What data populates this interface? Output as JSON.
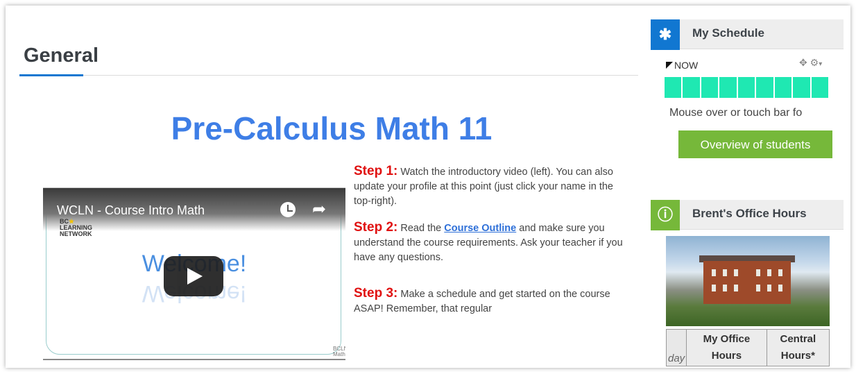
{
  "section": {
    "title": "General"
  },
  "course": {
    "title": "Pre-Calculus Math 11"
  },
  "video": {
    "title": "WCLN - Course Intro Math",
    "brand": [
      "BC",
      "LEARNING",
      "NETWORK"
    ],
    "welcome": "Welcome!",
    "corner": "BCLN Math"
  },
  "steps": [
    {
      "label": "Step 1:",
      "text": "Watch the introductory video (left). You can also update your profile at this point (just click your name in the top-right)."
    },
    {
      "label": "Step 2:",
      "text_before": "Read the",
      "link": "Course Outline",
      "text_after": "and make sure you understand the course requirements. Ask your teacher if you have any questions."
    },
    {
      "label": "Step 3:",
      "text": "Make a schedule and get started on the course ASAP! Remember, that regular"
    }
  ],
  "schedule_block": {
    "title": "My Schedule",
    "icon": "asterisk-icon",
    "accent": "#1177d1",
    "now_label": "NOW",
    "segments": 9,
    "segment_color": "#1fe8b2",
    "hint": "Mouse over or touch bar fo",
    "overview_button": "Overview of students",
    "button_color": "#76b83a"
  },
  "office_block": {
    "title": "Brent's Office Hours",
    "icon": "info-icon",
    "accent": "#76b83a",
    "table": {
      "day": "day",
      "col1": [
        "My Office",
        "Hours"
      ],
      "col2": [
        "Central",
        "Hours*"
      ]
    }
  }
}
